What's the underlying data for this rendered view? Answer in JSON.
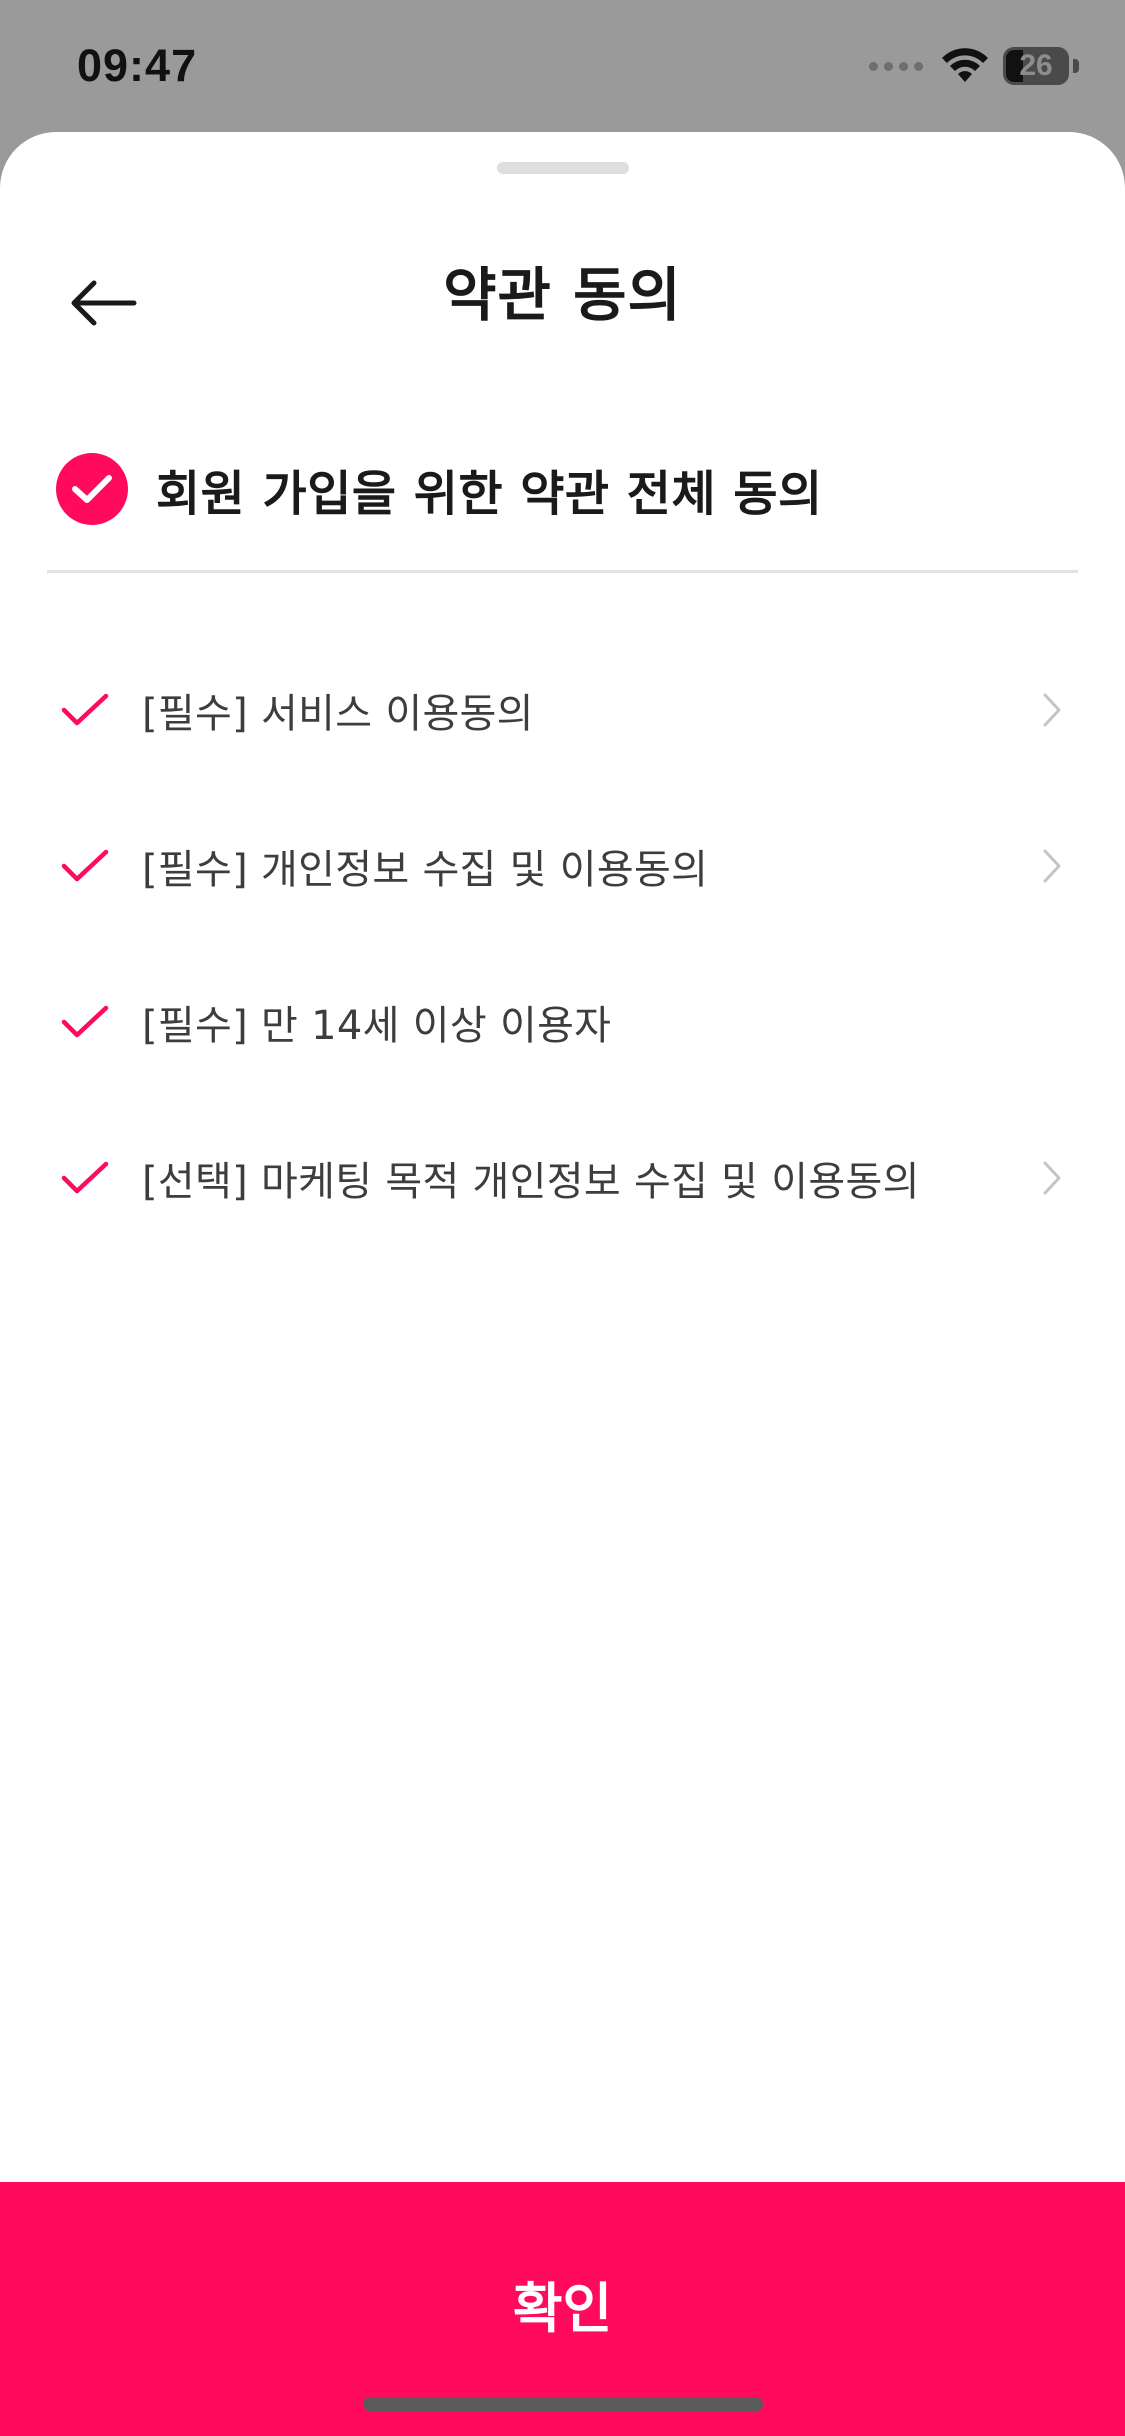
{
  "status_bar": {
    "time": "09:47",
    "battery": "26",
    "icons": [
      "signal-icon",
      "wifi-icon",
      "battery-icon"
    ]
  },
  "header": {
    "title": "약관 동의",
    "back_icon": "arrow-left-icon"
  },
  "agree_all": {
    "label": "회원 가입을 위한 약관 전체 동의",
    "checked": true
  },
  "terms": [
    {
      "label": "[필수] 서비스 이용동의",
      "checked": true,
      "has_detail": true
    },
    {
      "label": "[필수] 개인정보 수집 및 이용동의",
      "checked": true,
      "has_detail": true
    },
    {
      "label": "[필수] 만 14세 이상 이용자",
      "checked": true,
      "has_detail": false
    },
    {
      "label": "[선택] 마케팅 목적 개인정보 수집 및 이용동의",
      "checked": true,
      "has_detail": true
    }
  ],
  "confirm_button": {
    "label": "확인"
  },
  "colors": {
    "accent": "#ff0a5d",
    "text_primary": "#1a1a1a",
    "text_secondary": "#3d3d3d",
    "chevron": "#c4c4c4",
    "backdrop": "#9a9a9a"
  }
}
